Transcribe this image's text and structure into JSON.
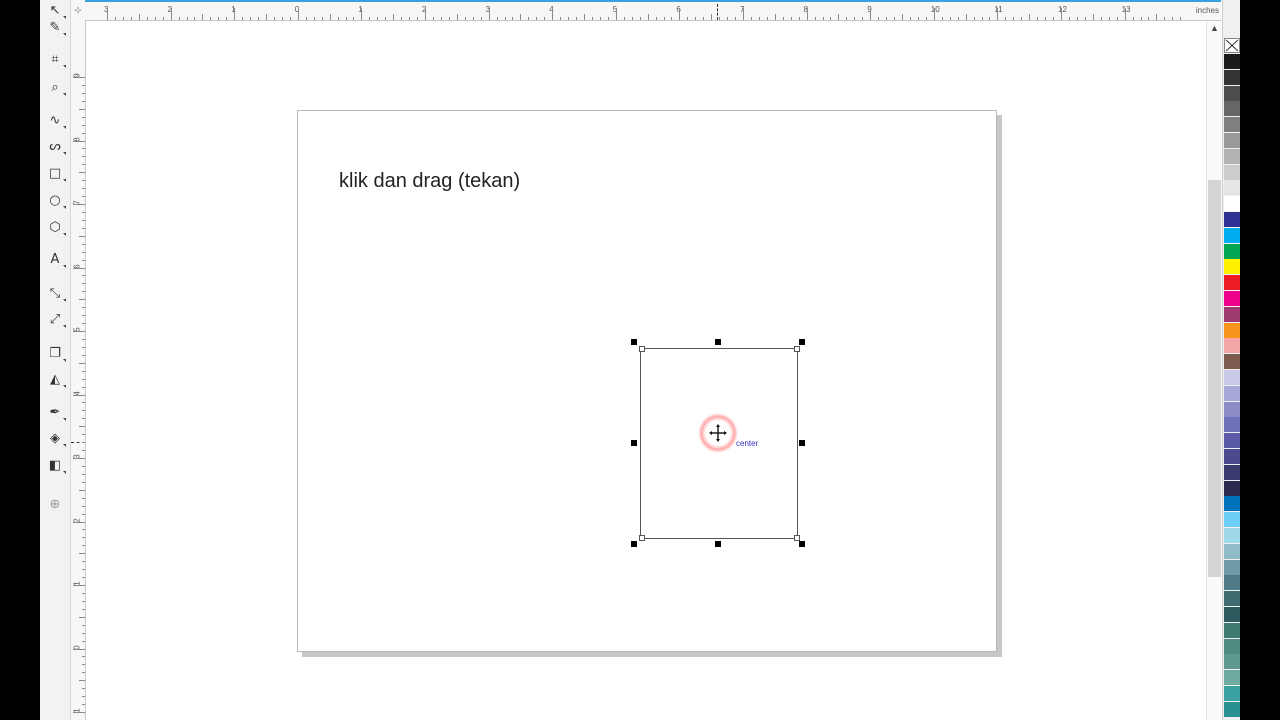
{
  "page": {
    "text": "klik dan drag (tekan)",
    "center_label": "center"
  },
  "ruler": {
    "units": "inches",
    "h_labels": [
      "3",
      "2",
      "1",
      "0",
      "1",
      "2",
      "3",
      "4",
      "5",
      "6",
      "7",
      "8",
      "9",
      "10",
      "11",
      "12",
      "13"
    ],
    "v_labels": [
      "9",
      "8",
      "7",
      "6",
      "5",
      "4",
      "3",
      "2",
      "1",
      "0",
      "1"
    ]
  },
  "toolbox": {
    "tools": [
      "pick-tool-icon",
      "shape-tool-icon",
      "crop-tool-icon",
      "zoom-tool-icon",
      "freehand-tool-icon",
      "artistic-media-tool-icon",
      "rectangle-tool-icon",
      "ellipse-tool-icon",
      "polygon-tool-icon",
      "text-tool-icon",
      "parallel-dimension-tool-icon",
      "connector-tool-icon",
      "drop-shadow-tool-icon",
      "transparency-tool-icon",
      "color-eyedropper-tool-icon",
      "interactive-fill-tool-icon",
      "smart-fill-tool-icon",
      "add-tool-icon"
    ]
  },
  "palette": {
    "colors": [
      "#1a1a1a",
      "#333333",
      "#4d4d4d",
      "#666666",
      "#7f7f7f",
      "#999999",
      "#b3b3b3",
      "#cccccc",
      "#e5e5e5",
      "#ffffff",
      "#2e3192",
      "#00aeef",
      "#00a651",
      "#fff200",
      "#ed1c24",
      "#ec008c",
      "#9e3a70",
      "#f7941d",
      "#f4a6a6",
      "#7d5b4f",
      "#c9c9e8",
      "#a6a6d8",
      "#8c8cc8",
      "#7070b8",
      "#5a5aa8",
      "#4a4a8c",
      "#3a3a6e",
      "#2b2b50",
      "#0072bc",
      "#6dcff6",
      "#9fd9e8",
      "#8fbcc8",
      "#6f9ba8",
      "#4f7a88",
      "#3f6a70",
      "#2f5a60",
      "#3f7a70",
      "#4f8a80",
      "#5f9a90",
      "#6faaa0",
      "#3aa0a0",
      "#2a9090"
    ]
  }
}
